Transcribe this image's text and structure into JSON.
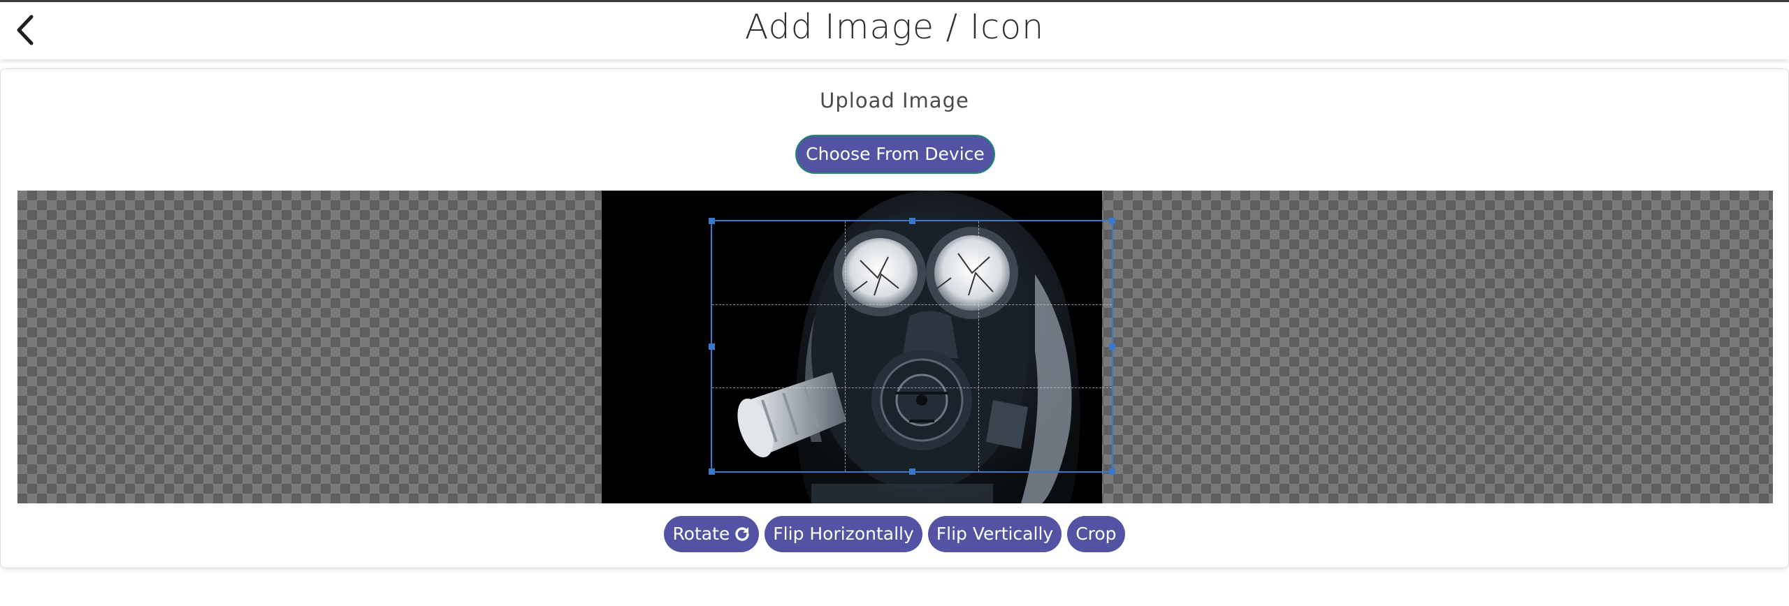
{
  "header": {
    "title": "Add Image / Icon",
    "back_icon": "chevron-left-icon"
  },
  "upload": {
    "label": "Upload Image",
    "choose_button": "Choose From Device"
  },
  "editor": {
    "image_description_icon": "gas-mask-photo"
  },
  "toolbar": {
    "rotate": "Rotate",
    "rotate_icon": "rotate-clockwise-icon",
    "flip_horizontal": "Flip Horizontally",
    "flip_vertical": "Flip Vertically",
    "crop": "Crop"
  },
  "colors": {
    "accent": "#5353a4",
    "focus_border": "#1f8a6e",
    "crop_border": "#3a78c9"
  }
}
